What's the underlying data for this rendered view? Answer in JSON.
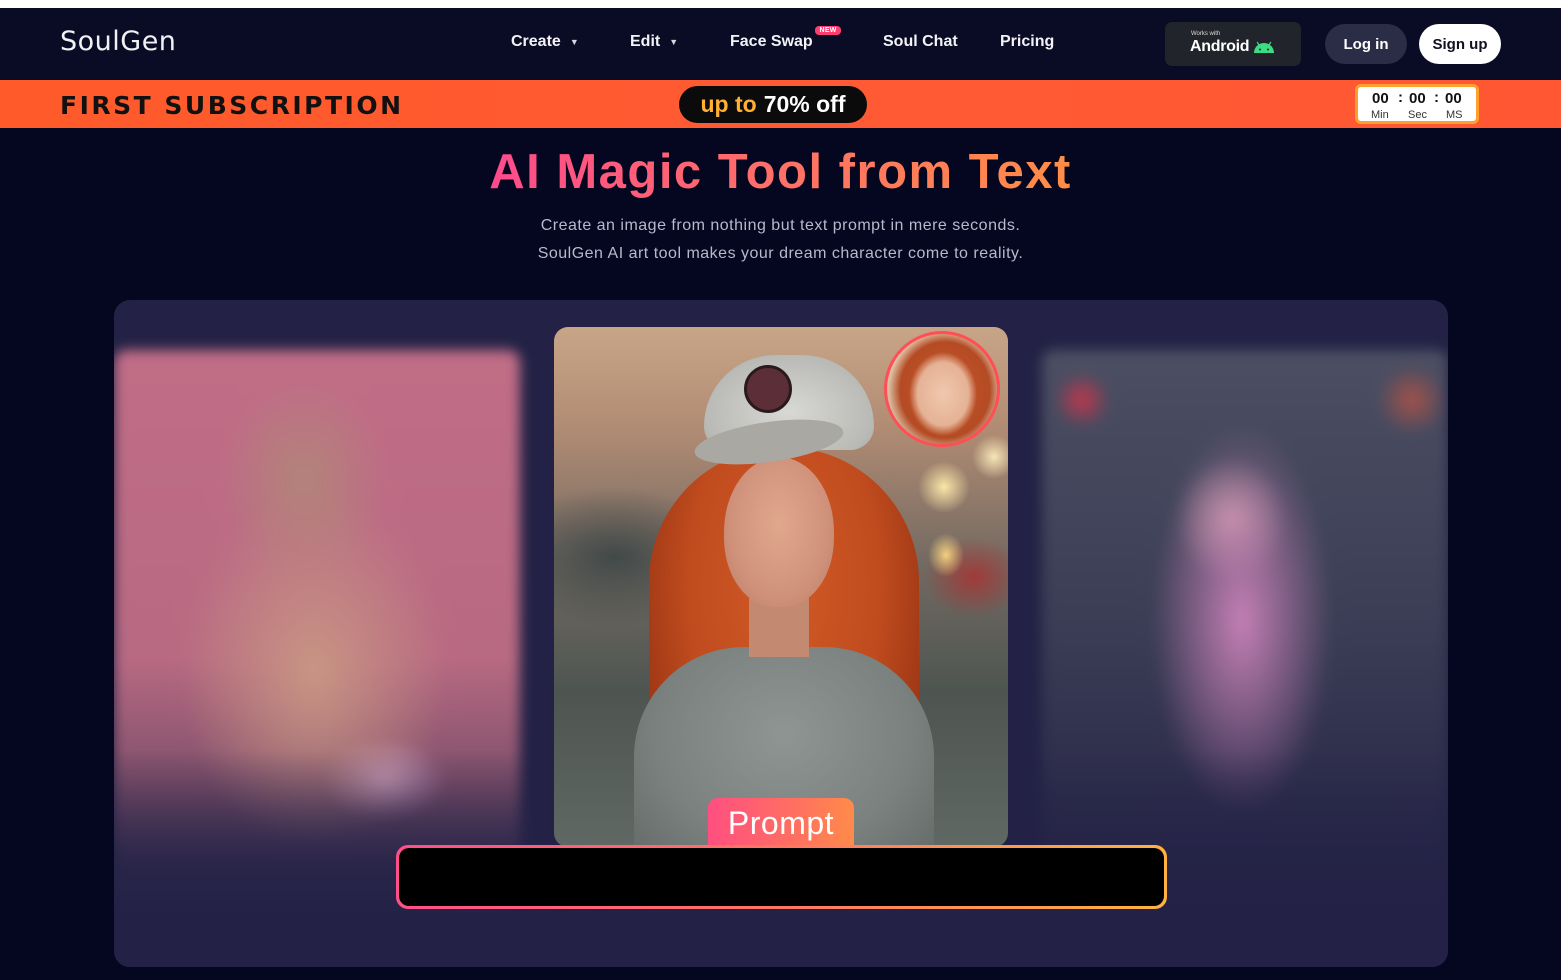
{
  "brand": {
    "logo_text": "SoulGen"
  },
  "nav": {
    "items": [
      {
        "label": "Create",
        "has_dropdown": true
      },
      {
        "label": "Edit",
        "has_dropdown": true
      },
      {
        "label": "Face Swap",
        "badge": "NEW"
      },
      {
        "label": "Soul Chat"
      },
      {
        "label": "Pricing"
      }
    ],
    "android": {
      "small_text": "Works with",
      "label": "Android",
      "icon": "android-icon"
    },
    "login_label": "Log in",
    "signup_label": "Sign up"
  },
  "promo": {
    "title": "FIRST SUBSCRIPTION",
    "pill_upto": "up to",
    "pill_off": "70% off",
    "countdown": {
      "min": "00",
      "sec": "00",
      "ms": "00",
      "separator": ":",
      "min_label": "Min",
      "sec_label": "Sec",
      "ms_label": "MS"
    }
  },
  "hero": {
    "title": "AI Magic Tool from Text",
    "subtitle_line1": "Create an image from nothing but text prompt in mere seconds.",
    "subtitle_line2": "SoulGen AI art tool makes your dream character come to reality."
  },
  "showcase": {
    "prompt_label": "Prompt",
    "prompt_text": ""
  },
  "colors": {
    "background": "#05061f",
    "navbar": "#0a0b24",
    "promo_orange": "#ff5a2a",
    "accent_pink": "#ff4f81",
    "accent_orange": "#ff8b4a",
    "badge_pink": "#ff3d72",
    "countdown_border": "#ffa02e"
  }
}
